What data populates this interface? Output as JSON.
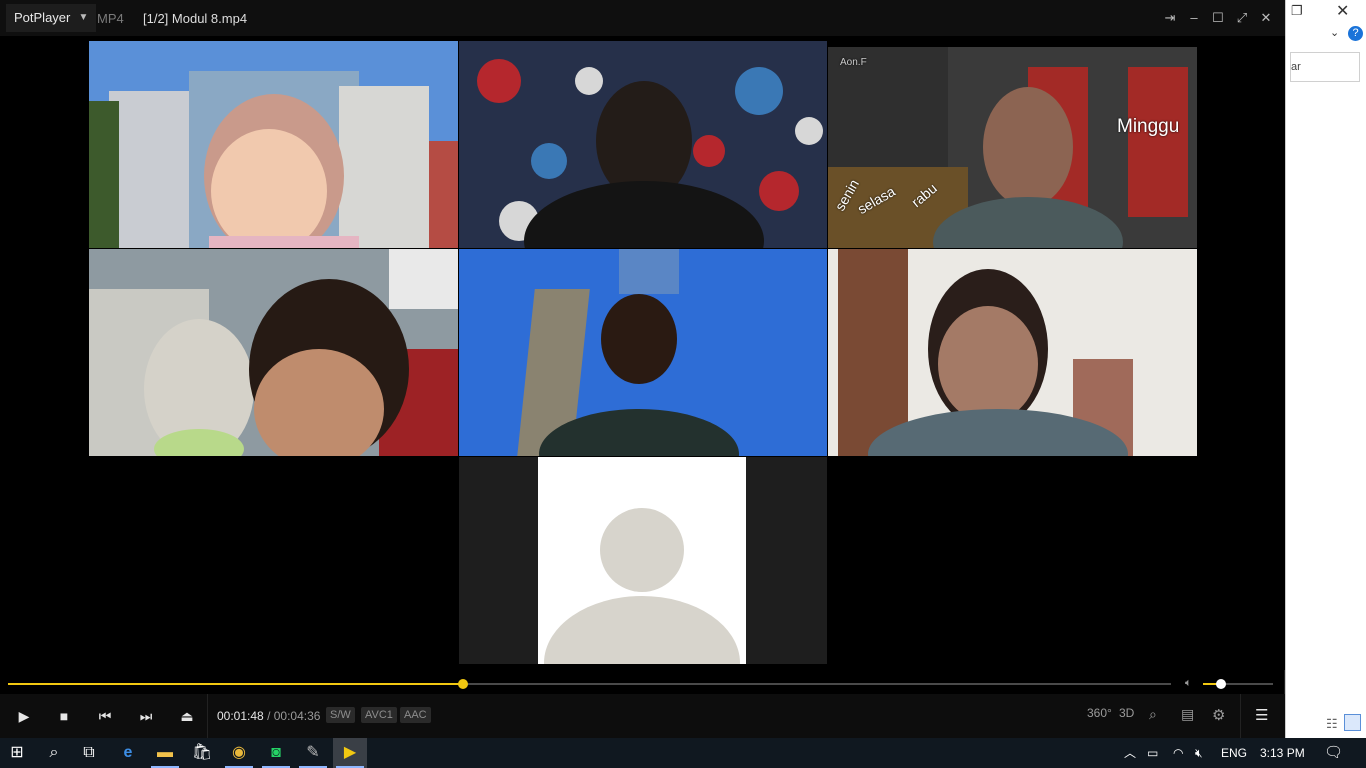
{
  "player": {
    "brand": "PotPlayer",
    "format": "MP4",
    "title": "[1/2] Modul 8.mp4"
  },
  "video": {
    "tile3_overlay": "Minggu",
    "tile3_watermark": "Aon.F",
    "tile3_days": [
      "senin",
      "selasa",
      "rabu"
    ]
  },
  "controls": {
    "current_time": "00:01:48",
    "time_separator": "/",
    "duration": "00:04:36",
    "progress_fraction": 0.391,
    "volume_fraction": 0.25,
    "tags": [
      "S/W",
      "AVC1",
      "AAC"
    ],
    "right_icons": [
      "360°",
      "3D"
    ]
  },
  "background_window": {
    "search_partial": "ar"
  },
  "taskbar": {
    "language": "ENG",
    "clock": "3:13 PM"
  },
  "colors": {
    "accent": "#f2c811",
    "taskbar": "#101820"
  }
}
